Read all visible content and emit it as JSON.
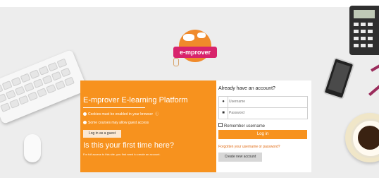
{
  "branding": {
    "logo_text": "e-mprover"
  },
  "left_panel": {
    "title": "E-mprover E-learning Platform",
    "notes": [
      "Cookies must be enabled in your browser",
      "Some courses may allow guest access"
    ],
    "guest_button": "Log in as a guest",
    "first_time_title": "Is this your first time here?",
    "first_time_desc": "For full access to this site, you first need to create an account."
  },
  "login": {
    "title": "Already have an account?",
    "username_placeholder": "Username",
    "password_placeholder": "Password",
    "remember_label": "Remember username",
    "login_button": "Log in",
    "forgot_link": "Forgotten your username or password?",
    "create_button": "Create new account"
  },
  "colors": {
    "accent": "#f7921e",
    "brand_pink": "#d8246c",
    "background": "#ededed"
  },
  "icons": [
    "user-icon",
    "lock-icon",
    "info-icon",
    "help-icon",
    "globe-icon"
  ]
}
